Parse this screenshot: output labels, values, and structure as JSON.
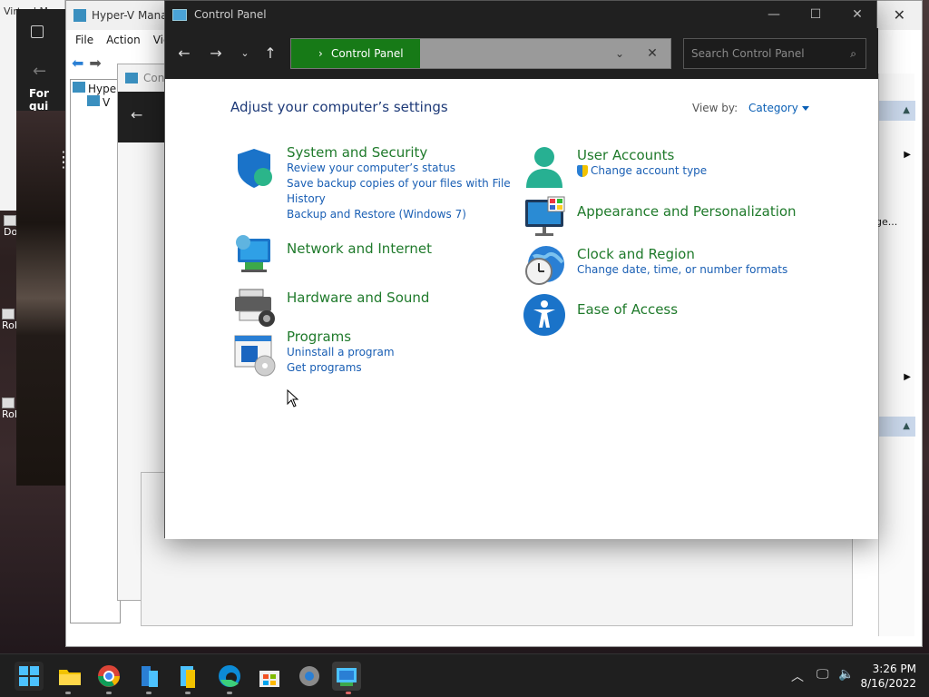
{
  "desktop": {
    "icons": [
      {
        "label": "Do"
      },
      {
        "label": "Rol"
      },
      {
        "label": "Rol"
      }
    ],
    "left_window_title": "Virtual M",
    "dark_window_text": "For qui"
  },
  "hyperv": {
    "title": "Hyper-V Manag",
    "menu": [
      "File",
      "Action",
      "Vie"
    ],
    "tree": [
      "Hype",
      "V"
    ],
    "right_texts": [
      "ge...",
      "..."
    ]
  },
  "mid_window": {
    "title": "Con"
  },
  "control_panel": {
    "title": "Control Panel",
    "address": {
      "crumb": "Control Panel"
    },
    "search": {
      "placeholder": "Search Control Panel"
    },
    "heading": "Adjust your computer’s settings",
    "view_by": {
      "label": "View by:",
      "value": "Category"
    },
    "categories_left": [
      {
        "title": "System and Security",
        "links": [
          "Review your computer’s status",
          "Save backup copies of your files with File",
          "History",
          "Backup and Restore (Windows 7)"
        ]
      },
      {
        "title": "Network and Internet",
        "links": []
      },
      {
        "title": "Hardware and Sound",
        "links": []
      },
      {
        "title": "Programs",
        "links": [
          "Uninstall a program",
          "Get programs"
        ]
      }
    ],
    "categories_right": [
      {
        "title": "User Accounts",
        "links": [
          "Change account type"
        ]
      },
      {
        "title": "Appearance and Personalization",
        "links": []
      },
      {
        "title": "Clock and Region",
        "links": [
          "Change date, time, or number formats"
        ]
      },
      {
        "title": "Ease of Access",
        "links": []
      }
    ]
  },
  "taskbar": {
    "apps": [
      "start-icon",
      "file-explorer-icon",
      "chrome-icon",
      "server-manager-icon",
      "hyperv-icon",
      "edge-icon",
      "store-icon",
      "settings-icon",
      "control-panel-icon"
    ],
    "time": "3:26 PM",
    "date": "8/16/2022"
  },
  "colors": {
    "accent_green": "#177a17",
    "link_blue": "#1a5fb4",
    "category_green": "#1f7a2b",
    "heading_blue": "#1e3a78",
    "title_bar": "#202020"
  }
}
